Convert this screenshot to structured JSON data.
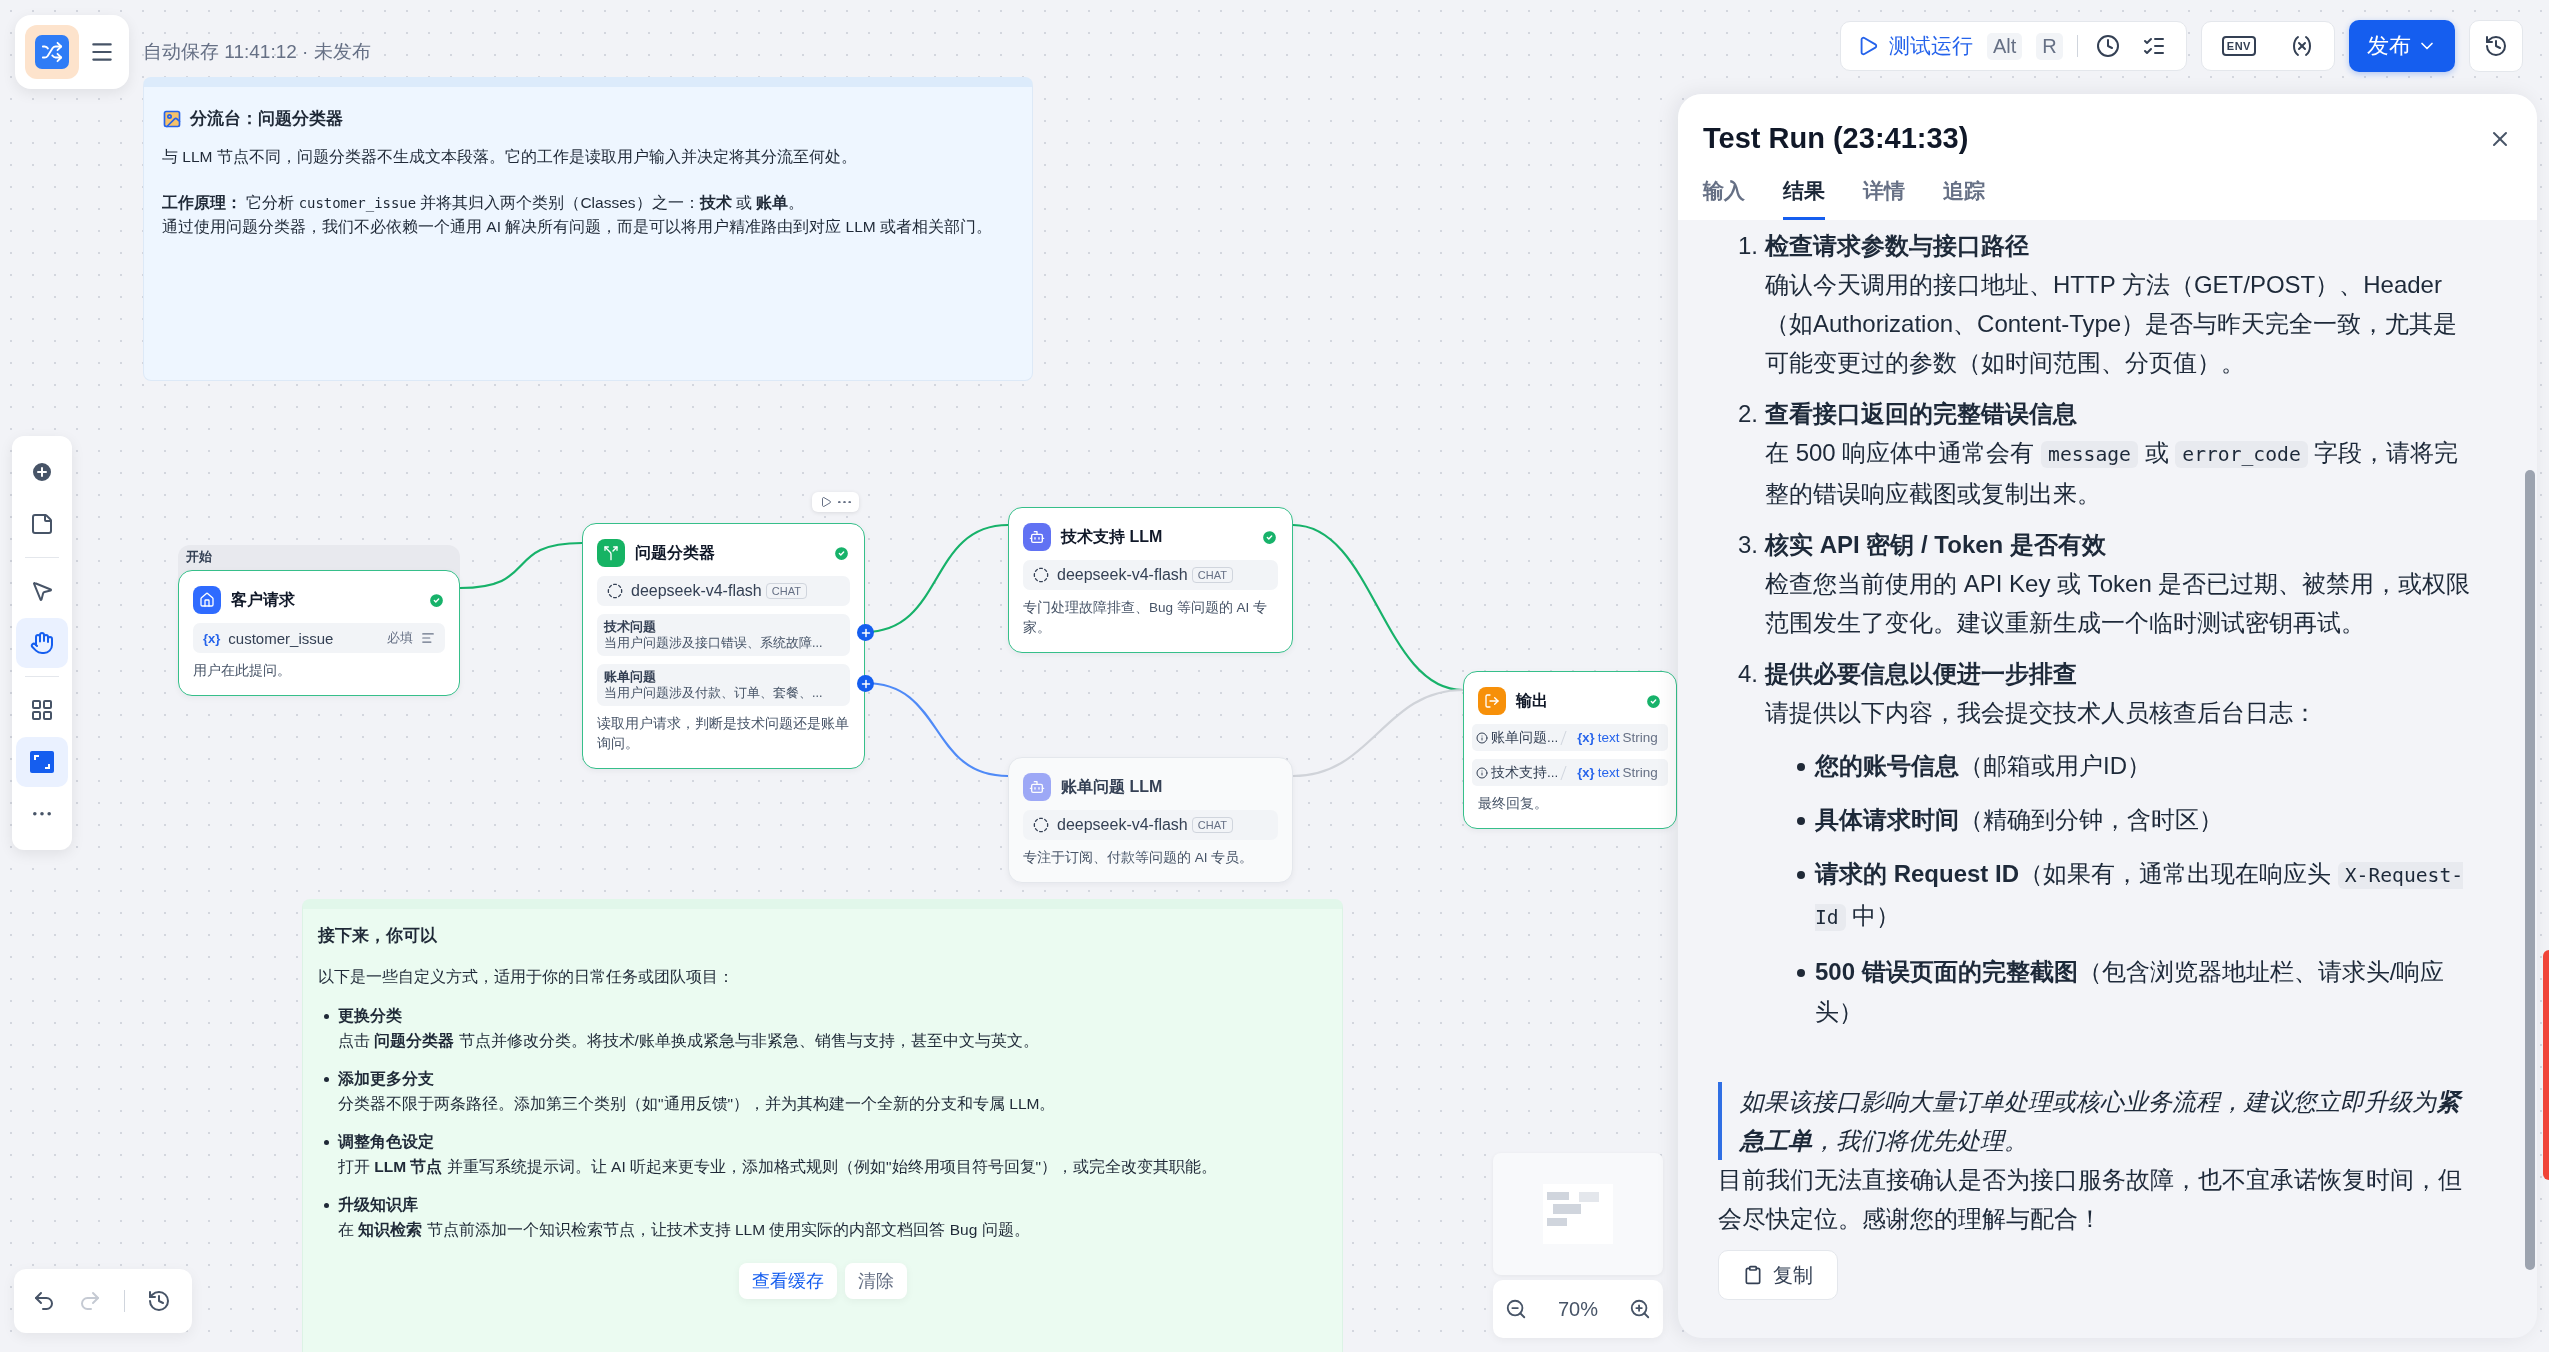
{
  "header": {
    "status": "自动保存 11:41:12 · 未发布"
  },
  "run_toolbar": {
    "run_label": "测试运行",
    "keys": [
      "Alt",
      "R"
    ],
    "env_label": "ENV",
    "publish_label": "发布"
  },
  "info_note": {
    "title": "分流台：问题分类器",
    "paragraphs": [
      {
        "lines": [
          [
            {
              "kind": "text",
              "text": "与 LLM 节点不同，问题分类器不生成文本段落。它的工作是读取用户输入并决定将其分流至何处。"
            }
          ]
        ]
      },
      {
        "lines": [
          [
            {
              "kind": "text",
              "text": "**工作原理：** 它分析 "
            },
            {
              "kind": "code",
              "text": "customer_issue"
            },
            {
              "kind": "text",
              "text": " 并将其归入两个类别（Classes）之一：**技术** 或 **账单**。"
            }
          ],
          [
            {
              "kind": "text",
              "text": "通过使用问题分类器，我们不必依赖一个通用 AI 解决所有问题，而是可以将用户精准路由到对应 LLM 或者相关部门。"
            }
          ]
        ]
      }
    ]
  },
  "tips_note": {
    "title": "接下来，你可以",
    "intro": "以下是一些自定义方式，适用于你的日常任务或团队项目：",
    "items": [
      {
        "title": "更换分类",
        "body": "点击 **问题分类器** 节点并修改分类。将技术/账单换成紧急与非紧急、销售与支持，甚至中文与英文。"
      },
      {
        "title": "添加更多分支",
        "body": "分类器不限于两条路径。添加第三个类别（如\"通用反馈\"），并为其构建一个全新的分支和专属 LLM。"
      },
      {
        "title": "调整角色设定",
        "body": "打开 **LLM 节点** 并重写系统提示词。让 AI 听起来更专业，添加格式规则（例如\"始终用项目符号回复\"），或完全改变其职能。"
      },
      {
        "title": "升级知识库",
        "body": "在 **知识检索** 节点前添加一个知识检索节点，让技术支持 LLM 使用实际的内部文档回答 Bug 问题。"
      }
    ],
    "buttons": [
      {
        "label": "查看缓存",
        "kind": "primary"
      },
      {
        "label": "清除",
        "kind": "plain"
      }
    ]
  },
  "canvas": {
    "start_group_label": "开始",
    "nodes": [
      {
        "kind": "start",
        "title": "客户请求",
        "ran": true,
        "variable": {
          "prefix": "{x}",
          "name": "customer_issue",
          "required": "必填"
        },
        "description": "用户在此提问。"
      },
      {
        "kind": "classifier",
        "title": "问题分类器",
        "ran": true,
        "model": "deepseek-v4-flash",
        "model_tag": "CHAT",
        "classes": [
          {
            "name": "技术问题",
            "description": "当用户问题涉及接口错误、系统故障..."
          },
          {
            "name": "账单问题",
            "description": "当用户问题涉及付款、订单、套餐、..."
          }
        ],
        "description": "读取用户请求，判断是技术问题还是账单询问。"
      },
      {
        "kind": "llm",
        "title": "技术支持 LLM",
        "ran": true,
        "model": "deepseek-v4-flash",
        "model_tag": "CHAT",
        "description": "专门处理故障排查、Bug 等问题的 AI 专家。"
      },
      {
        "kind": "llm",
        "title": "账单问题 LLM",
        "ran": false,
        "model": "deepseek-v4-flash",
        "model_tag": "CHAT",
        "description": "专注于订阅、付款等问题的 AI 专员。"
      },
      {
        "kind": "output",
        "title": "输出",
        "ran": true,
        "outputs": [
          {
            "source": "账单问题...",
            "prefix": "{x}",
            "variable": "text",
            "type": "String"
          },
          {
            "source": "技术支持...",
            "prefix": "{x}",
            "variable": "text",
            "type": "String"
          }
        ],
        "description": "最终回复。"
      }
    ]
  },
  "tool_groups": [
    [
      {
        "kind": "add",
        "selected": false
      },
      {
        "kind": "note",
        "selected": false
      }
    ],
    [
      {
        "kind": "pointer",
        "selected": false
      },
      {
        "kind": "hand",
        "selected": true
      }
    ],
    [
      {
        "kind": "grid",
        "selected": false
      },
      {
        "kind": "fit",
        "selected": true
      },
      {
        "kind": "more",
        "selected": false
      }
    ]
  ],
  "zoom": {
    "level_label": "70%"
  },
  "panel": {
    "title": "Test Run (23:41:33)",
    "tabs": [
      {
        "label": "输入",
        "selected": false
      },
      {
        "label": "结果",
        "selected": true
      },
      {
        "label": "详情",
        "selected": false
      },
      {
        "label": "追踪",
        "selected": false
      }
    ],
    "steps": [
      {
        "number": "1.",
        "title": "检查请求参数与接口路径",
        "body": [
          {
            "kind": "text",
            "text": "确认今天调用的接口地址、HTTP 方法（GET/POST）、Header（如Authorization、Content-Type）是否与昨天完全一致，尤其是可能变更过的参数（如时间范围、分页值）。"
          }
        ]
      },
      {
        "number": "2.",
        "title": "查看接口返回的完整错误信息",
        "body": [
          {
            "kind": "text",
            "text": "在 500 响应体中通常会有 "
          },
          {
            "kind": "code",
            "text": "message"
          },
          {
            "kind": "text",
            "text": " 或 "
          },
          {
            "kind": "code",
            "text": "error_code"
          },
          {
            "kind": "text",
            "text": " 字段，请将完整的错误响应截图或复制出来。"
          }
        ]
      },
      {
        "number": "3.",
        "title": "核实 API 密钥 / Token 是否有效",
        "body": [
          {
            "kind": "text",
            "text": "检查您当前使用的 API Key 或 Token 是否已过期、被禁用，或权限范围发生了变化。建议重新生成一个临时测试密钥再试。"
          }
        ]
      },
      {
        "number": "4.",
        "title": "提供必要信息以便进一步排查",
        "body": [
          {
            "kind": "text",
            "text": "请提供以下内容，我会提交技术人员核查后台日志："
          }
        ],
        "bullets": [
          [
            {
              "kind": "text",
              "text": "**您的账号信息**（邮箱或用户ID）"
            }
          ],
          [
            {
              "kind": "text",
              "text": "**具体请求时间**（精确到分钟，含时区）"
            }
          ],
          [
            {
              "kind": "text",
              "text": "**请求的 Request ID**（如果有，通常出现在响应头 "
            },
            {
              "kind": "code",
              "text": "X-Request-Id"
            },
            {
              "kind": "text",
              "text": " 中）"
            }
          ],
          [
            {
              "kind": "text",
              "text": "**500 错误页面的完整截图**（包含浏览器地址栏、请求头/响应头）"
            }
          ]
        ]
      }
    ],
    "quote": "如果该接口影响大量订单处理或核心业务流程，建议您立即升级为**紧急工单**，我们将优先处理。",
    "closing": "目前我们无法直接确认是否为接口服务故障，也不宜承诺恢复时间，但会尽快定位。感谢您的理解与配合！",
    "copy_label": "复制"
  }
}
